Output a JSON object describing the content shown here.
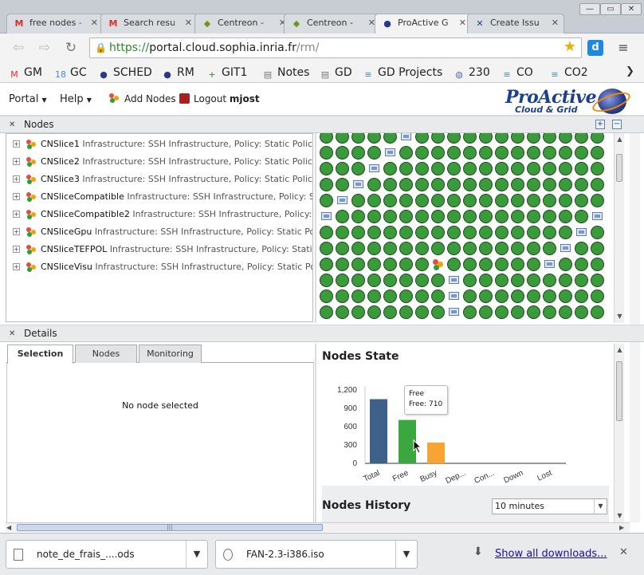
{
  "browser": {
    "tabs": [
      {
        "title": "free nodes -",
        "icon": "gmail-icon",
        "glyph": "M",
        "color": "#d93025"
      },
      {
        "title": "Search resu",
        "icon": "gmail-icon",
        "glyph": "M",
        "color": "#d93025"
      },
      {
        "title": "Centreon -",
        "icon": "centreon-icon",
        "glyph": "◆",
        "color": "#6a9a1f"
      },
      {
        "title": "Centreon -",
        "icon": "centreon-icon",
        "glyph": "◆",
        "color": "#6a9a1f"
      },
      {
        "title": "ProActive G",
        "icon": "proactive-icon",
        "glyph": "●",
        "color": "#27398c"
      },
      {
        "title": "Create Issu",
        "icon": "jira-icon",
        "glyph": "✕",
        "color": "#1d3f8f"
      }
    ],
    "url_scheme": "https://",
    "url_host": "portal.cloud.sophia.inria.fr",
    "url_path": "/rm/",
    "bookmarks": [
      {
        "label": "GM",
        "icon": "gmail-icon",
        "glyph": "M",
        "color": "#d93025"
      },
      {
        "label": "GC",
        "icon": "calendar-icon",
        "glyph": "18",
        "color": "#4285f4"
      },
      {
        "label": "SCHED",
        "icon": "proactive-icon",
        "glyph": "●",
        "color": "#27398c"
      },
      {
        "label": "RM",
        "icon": "proactive-icon",
        "glyph": "●",
        "color": "#27398c"
      },
      {
        "label": "GIT1",
        "icon": "plus-box-icon",
        "glyph": "+",
        "color": "#2e8b2e"
      },
      {
        "label": "Notes",
        "icon": "page-icon",
        "glyph": "▤",
        "color": "#777"
      },
      {
        "label": "GD",
        "icon": "page-icon",
        "glyph": "▤",
        "color": "#777"
      },
      {
        "label": "GD Projects",
        "icon": "doc-icon",
        "glyph": "≡",
        "color": "#4285f4"
      },
      {
        "label": "230",
        "icon": "globe-icon",
        "glyph": "◍",
        "color": "#5a6fb8"
      },
      {
        "label": "CO",
        "icon": "doc-icon",
        "glyph": "≡",
        "color": "#4285f4"
      },
      {
        "label": "CO2",
        "icon": "doc-icon",
        "glyph": "≡",
        "color": "#4285f4"
      }
    ]
  },
  "app": {
    "menu_portal": "Portal",
    "menu_help": "Help",
    "add_nodes": "Add Nodes",
    "logout": "Logout",
    "username": "mjost",
    "logo_main": "ProActive",
    "logo_sub": "Cloud & Grid"
  },
  "nodes": {
    "header": "Nodes",
    "sources": [
      {
        "name": "CNSlice1",
        "desc": "Infrastructure: SSH Infrastructure, Policy: Static Policy use"
      },
      {
        "name": "CNSlice2",
        "desc": "Infrastructure: SSH Infrastructure, Policy: Static Policy use"
      },
      {
        "name": "CNSlice3",
        "desc": "Infrastructure: SSH Infrastructure, Policy: Static Policy use"
      },
      {
        "name": "CNSliceCompatible",
        "desc": "Infrastructure: SSH Infrastructure, Policy: Static"
      },
      {
        "name": "CNSliceCompatible2",
        "desc": "Infrastructure: SSH Infrastructure, Policy: Static"
      },
      {
        "name": "CNSliceGpu",
        "desc": "Infrastructure: SSH Infrastructure, Policy: Static Policy u"
      },
      {
        "name": "CNSliceTEFPOL",
        "desc": "Infrastructure: SSH Infrastructure, Policy: Static Pol"
      },
      {
        "name": "CNSliceVisu",
        "desc": "Infrastructure: SSH Infrastructure, Policy: Static Policy"
      }
    ]
  },
  "details": {
    "header": "Details",
    "tabs": [
      "Selection",
      "Nodes",
      "Monitoring"
    ],
    "active_tab": "Selection",
    "empty_message": "No node selected",
    "state_title": "Nodes State",
    "history_title": "Nodes History",
    "history_range": "10 minutes",
    "tooltip_title": "Free",
    "tooltip_value": "Free: 710"
  },
  "chart_data": {
    "type": "bar",
    "title": "Nodes State",
    "categories": [
      "Total",
      "Free",
      "Busy",
      "Dep...",
      "Con...",
      "Down",
      "Lost"
    ],
    "values": [
      1050,
      710,
      340,
      0,
      0,
      0,
      0
    ],
    "colors": [
      "#3e6189",
      "#3aa83f",
      "#f7a433",
      "#999999",
      "#999999",
      "#999999",
      "#999999"
    ],
    "yticks": [
      0,
      300,
      600,
      900,
      1200
    ],
    "ytick_labels": [
      "0",
      "300",
      "600",
      "900",
      "1,200"
    ],
    "ylim": [
      0,
      1200
    ],
    "grid": false
  },
  "downloads": {
    "items": [
      {
        "name": "note_de_frais_....ods"
      },
      {
        "name": "FAN-2.3-i386.iso"
      }
    ],
    "show_all": "Show all downloads..."
  }
}
